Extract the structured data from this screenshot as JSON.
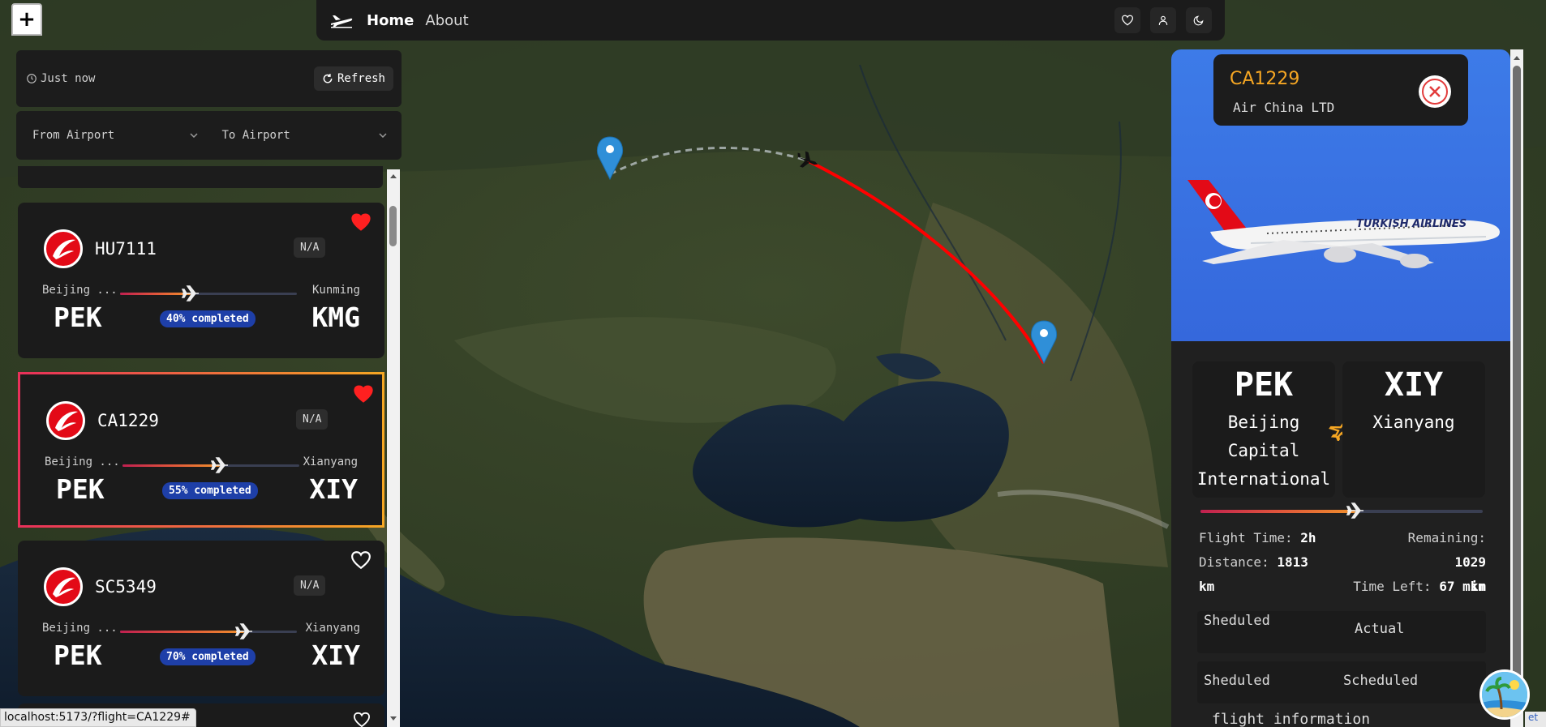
{
  "nav": {
    "home_label": "Home",
    "about_label": "About",
    "icons": [
      "plane-logo-icon",
      "heart-icon",
      "user-icon",
      "moon-icon"
    ]
  },
  "map": {
    "zoom_in_label": "+"
  },
  "toolbar": {
    "last_updated": "Just now",
    "refresh_label": "Refresh"
  },
  "filters": {
    "from_placeholder": "From Airport",
    "to_placeholder": "To Airport"
  },
  "flights": [
    {
      "code": "HU7111",
      "status": "N/A",
      "from_city": "Beijing ...",
      "from_code": "PEK",
      "to_city": "Kunming",
      "to_code": "KMG",
      "progress": 40,
      "progress_label": "40% completed",
      "favorite": true,
      "selected": false
    },
    {
      "code": "CA1229",
      "status": "N/A",
      "from_city": "Beijing ...",
      "from_code": "PEK",
      "to_city": "Xianyang",
      "to_code": "XIY",
      "progress": 55,
      "progress_label": "55% completed",
      "favorite": true,
      "selected": true
    },
    {
      "code": "SC5349",
      "status": "N/A",
      "from_city": "Beijing ...",
      "from_code": "PEK",
      "to_city": "Xianyang",
      "to_code": "XIY",
      "progress": 70,
      "progress_label": "70% completed",
      "favorite": false,
      "selected": false
    }
  ],
  "status_url": "localhost:5173/?flight=CA1229#",
  "detail": {
    "flight_code": "CA1229",
    "airline": "Air China LTD",
    "aircraft_livery": "TURKISH AIRLINES",
    "origin": {
      "code": "PEK",
      "name_line1": "Beijing",
      "name_line2": "Capital",
      "name_line3": "International"
    },
    "destination": {
      "code": "XIY",
      "name_line1": "Xianyang"
    },
    "progress": 55,
    "flight_time_label": "Flight Time:",
    "flight_time_value": "2h",
    "remaining_label": "Remaining:",
    "remaining_value": "1029",
    "remaining_unit": "km",
    "distance_label": "Distance:",
    "distance_value": "1813",
    "distance_unit": "km",
    "time_left_label": "Time Left:",
    "time_left_value": "67 min",
    "schedule": {
      "row1_left": "Sheduled",
      "row1_right": "Actual",
      "row2_left": "Sheduled",
      "row2_right": "Scheduled"
    },
    "info_label": "flight information"
  },
  "attribution_stub": "et",
  "colors": {
    "accent_orange": "#f5a623",
    "selected_border_start": "#e8305a",
    "route_red": "#ff0000",
    "progress_pill": "#1e3fa8",
    "brand_red": "#e30a17",
    "detail_hero_blue": "#3d7be8"
  }
}
